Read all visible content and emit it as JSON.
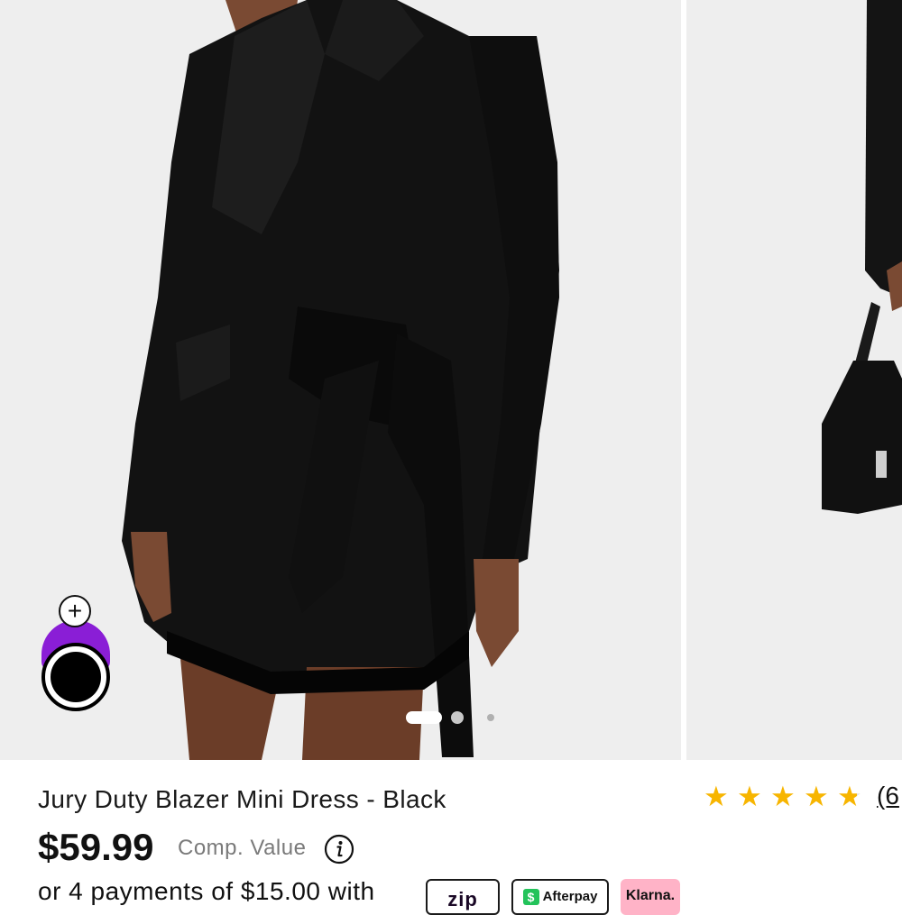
{
  "product": {
    "title": "Jury Duty Blazer Mini Dress - Black",
    "price": "$59.99",
    "comp_value_label": "Comp. Value",
    "rating": 4.5,
    "rating_max": 5,
    "review_count": "(6"
  },
  "payments": {
    "text": "or 4 payments of $15.00 with",
    "providers": [
      "zip",
      "Afterpay",
      "Klarna."
    ]
  },
  "gallery": {
    "current_slide": 1,
    "slide_count": 3
  },
  "icons": {
    "style_avatar_add": "plus-icon",
    "share": "share-icon",
    "info": "info-icon",
    "star": "star-icon"
  },
  "colors": {
    "star": "#f7b500",
    "avatar_purple": "#8a1ed6",
    "afterpay_green": "#23c35a",
    "klarna_pink": "#ffb3c7"
  }
}
